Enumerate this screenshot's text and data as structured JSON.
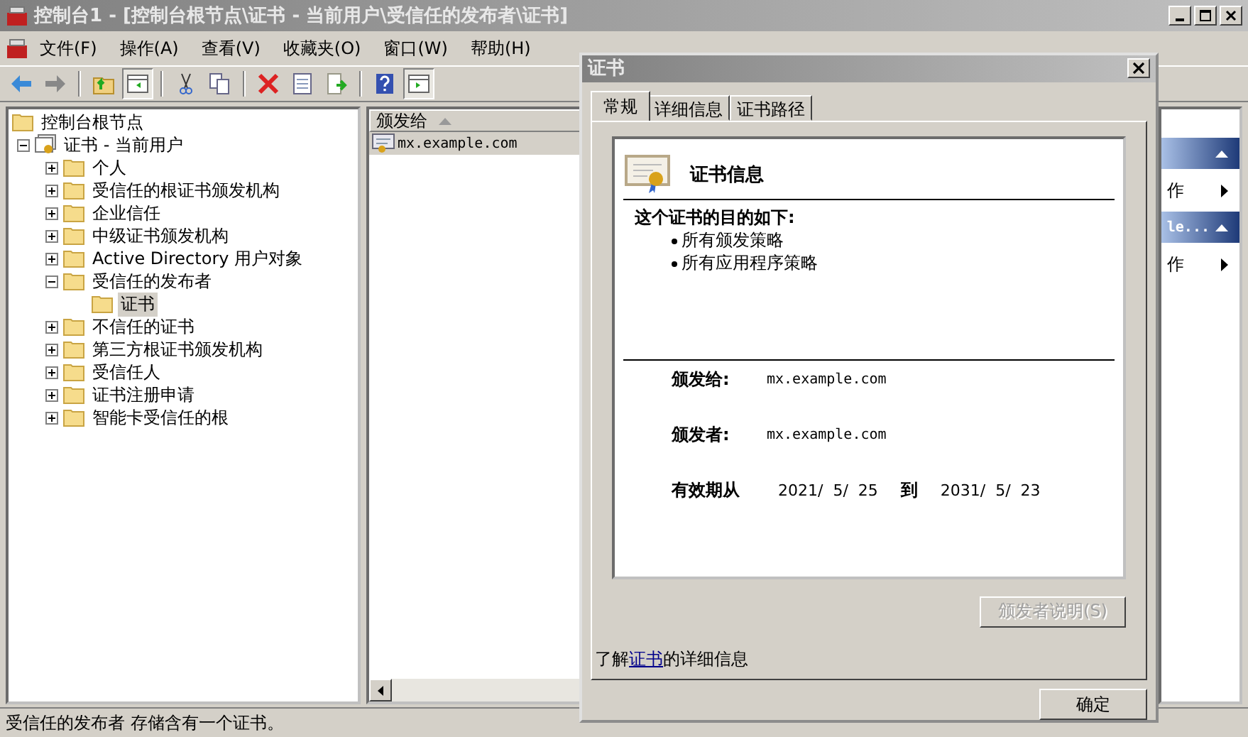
{
  "window": {
    "title": "控制台1 - [控制台根节点\\证书 - 当前用户\\受信任的发布者\\证书]"
  },
  "menu": [
    "文件(F)",
    "操作(A)",
    "查看(V)",
    "收藏夹(O)",
    "窗口(W)",
    "帮助(H)"
  ],
  "toolbar": [
    {
      "kind": "back",
      "pressed": false
    },
    {
      "kind": "forward",
      "pressed": false
    },
    {
      "kind": "sep"
    },
    {
      "kind": "up",
      "pressed": false
    },
    {
      "kind": "tree",
      "pressed": true
    },
    {
      "kind": "sep"
    },
    {
      "kind": "cut",
      "pressed": false
    },
    {
      "kind": "copy",
      "pressed": false
    },
    {
      "kind": "sep"
    },
    {
      "kind": "delete",
      "pressed": false
    },
    {
      "kind": "properties",
      "pressed": false
    },
    {
      "kind": "export",
      "pressed": false
    },
    {
      "kind": "sep"
    },
    {
      "kind": "help",
      "pressed": false
    },
    {
      "kind": "pane",
      "pressed": true
    }
  ],
  "tree": [
    {
      "label": "控制台根节点",
      "kind": "root",
      "selected": false,
      "children": [
        {
          "label": "证书 - 当前用户",
          "kind": "store",
          "selected": false,
          "expanded": true,
          "children": [
            {
              "label": "个人",
              "kind": "folder",
              "selected": false,
              "expanded": false
            },
            {
              "label": "受信任的根证书颁发机构",
              "kind": "folder",
              "selected": false,
              "expanded": false
            },
            {
              "label": "企业信任",
              "kind": "folder",
              "selected": false,
              "expanded": false
            },
            {
              "label": "中级证书颁发机构",
              "kind": "folder",
              "selected": false,
              "expanded": false
            },
            {
              "label": "Active Directory 用户对象",
              "kind": "folder",
              "selected": false,
              "expanded": false
            },
            {
              "label": "受信任的发布者",
              "kind": "folder",
              "selected": false,
              "expanded": true,
              "children": [
                {
                  "label": "证书",
                  "kind": "folder",
                  "selected": true
                }
              ]
            },
            {
              "label": "不信任的证书",
              "kind": "folder",
              "selected": false,
              "expanded": false
            },
            {
              "label": "第三方根证书颁发机构",
              "kind": "folder",
              "selected": false,
              "expanded": false
            },
            {
              "label": "受信任人",
              "kind": "folder",
              "selected": false,
              "expanded": false
            },
            {
              "label": "证书注册申请",
              "kind": "folder",
              "selected": false,
              "expanded": false
            },
            {
              "label": "智能卡受信任的根",
              "kind": "folder",
              "selected": false,
              "expanded": false
            }
          ]
        }
      ]
    }
  ],
  "list": {
    "columns": [
      {
        "label": "颁发给",
        "sorted": true
      }
    ],
    "rows": [
      {
        "cells": [
          "mx.example.com"
        ],
        "selected": true
      }
    ]
  },
  "actions": [
    {
      "items": [
        "作"
      ]
    },
    {
      "title": "le...",
      "items": [
        "作"
      ]
    }
  ],
  "status_bar": "受信任的发布者  存储含有一个证书。",
  "dialog": {
    "title": "证书",
    "tabs": [
      {
        "label": "常规",
        "selected": true
      },
      {
        "label": "详细信息",
        "selected": false
      },
      {
        "label": "证书路径",
        "selected": false
      }
    ],
    "heading": "证书信息",
    "purpose_title": "这个证书的目的如下:",
    "purposes": [
      "所有颁发策略",
      "所有应用程序策略"
    ],
    "issued_to": {
      "label": "颁发给:",
      "value": "mx.example.com"
    },
    "issued_by": {
      "label": "颁发者:",
      "value": "mx.example.com"
    },
    "validity": {
      "label": "有效期从",
      "from": "2021/  5/  25",
      "to_label": "到",
      "to": "2031/  5/  23"
    },
    "statement_button": {
      "label": "颁发者说明(S)",
      "disabled": true
    },
    "learn_more": {
      "before": "了解",
      "link": "证书",
      "after": "的详细信息"
    },
    "ok_button": "确定"
  }
}
